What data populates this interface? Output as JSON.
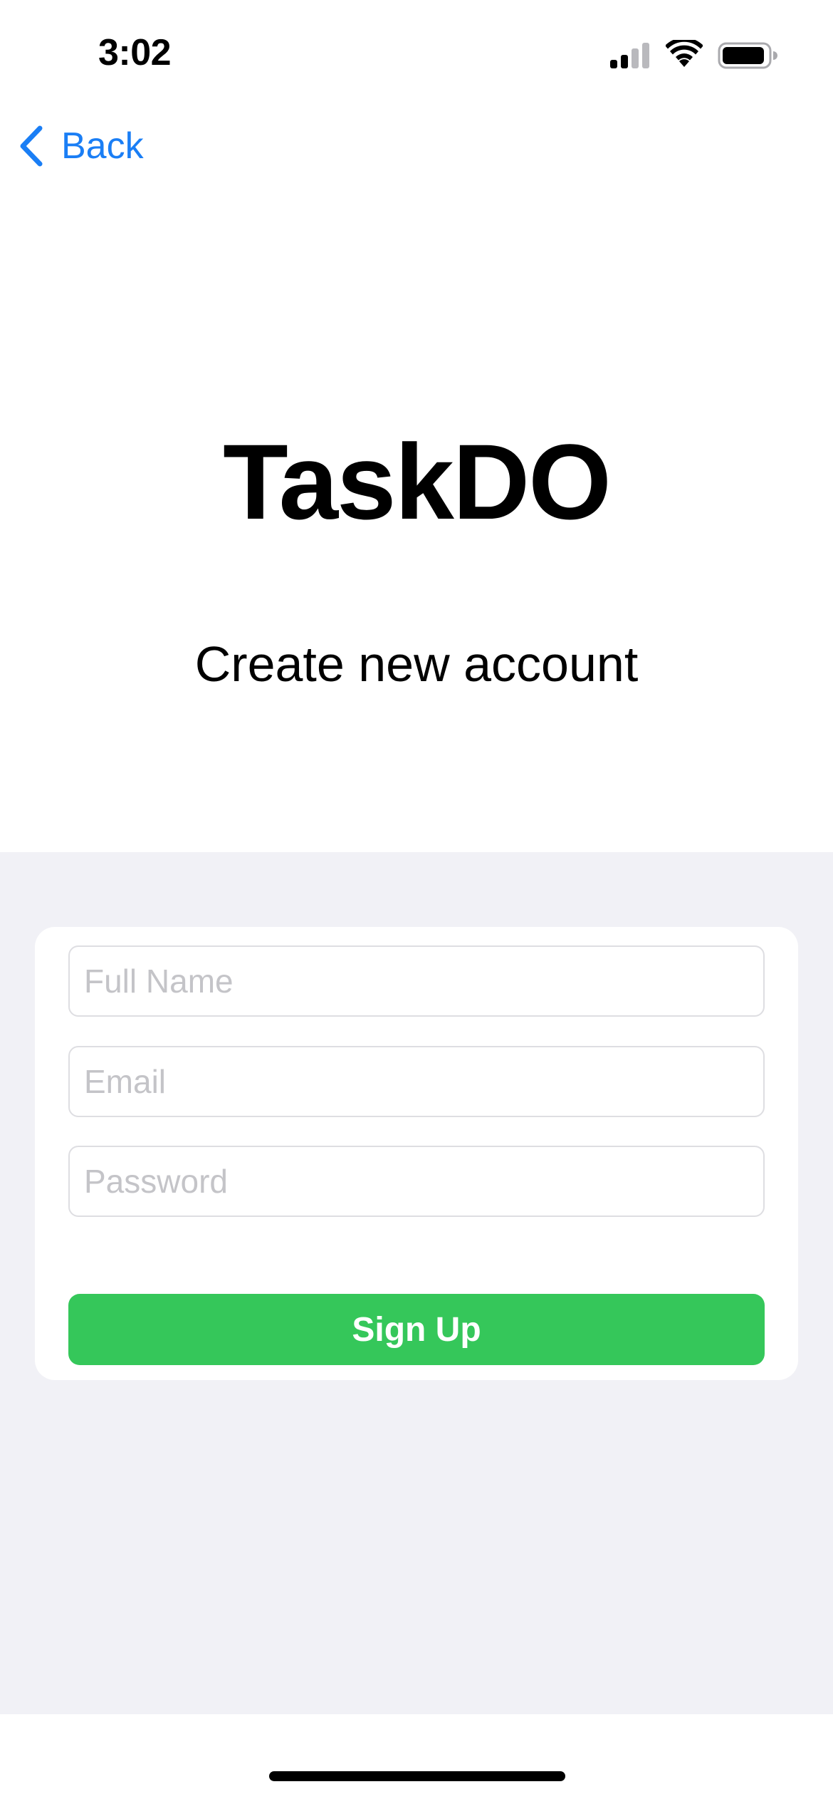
{
  "status_bar": {
    "time": "3:02",
    "signal_icon": "cellular-signal-icon",
    "wifi_icon": "wifi-icon",
    "battery_icon": "battery-icon"
  },
  "nav": {
    "back_label": "Back",
    "back_icon": "chevron-left-icon"
  },
  "header": {
    "app_title": "TaskDO",
    "subtitle": "Create new account"
  },
  "form": {
    "full_name": {
      "placeholder": "Full Name",
      "value": ""
    },
    "email": {
      "placeholder": "Email",
      "value": ""
    },
    "password": {
      "placeholder": "Password",
      "value": ""
    },
    "submit_label": "Sign Up"
  },
  "colors": {
    "accent_blue": "#1a7ef5",
    "button_green": "#35c75a",
    "section_background": "#f1f1f6"
  }
}
